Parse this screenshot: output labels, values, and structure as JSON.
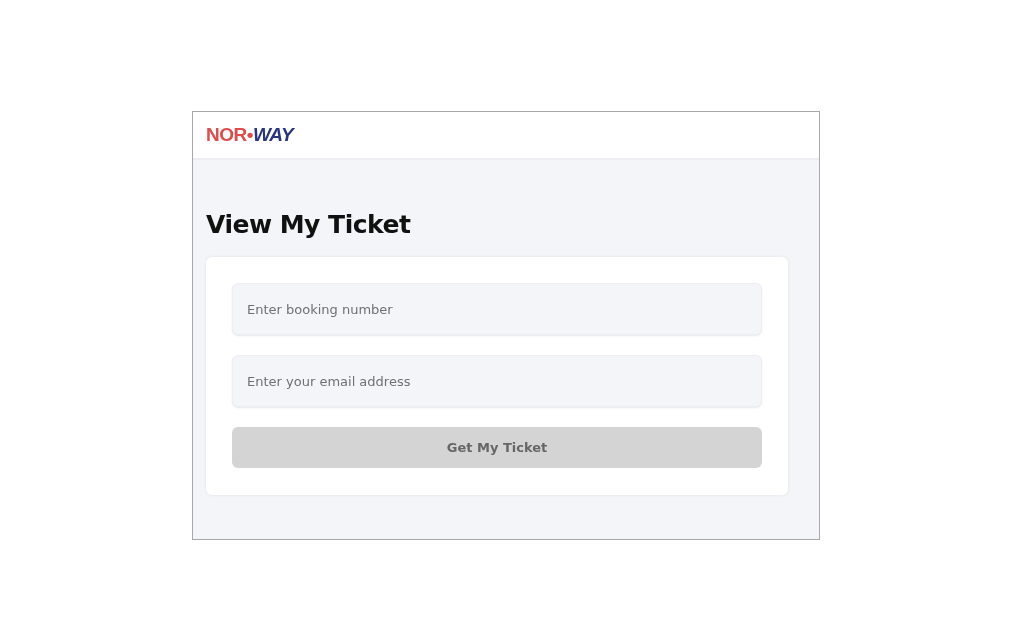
{
  "header": {
    "logo": {
      "part_1": "NOR•",
      "part_2": "WAY"
    }
  },
  "title": "View My Ticket",
  "form": {
    "fields": [
      {
        "placeholder": "Enter booking number"
      },
      {
        "placeholder": "Enter your email address"
      }
    ],
    "button": {
      "label": "Get My Ticket",
      "disabled": true
    }
  }
}
